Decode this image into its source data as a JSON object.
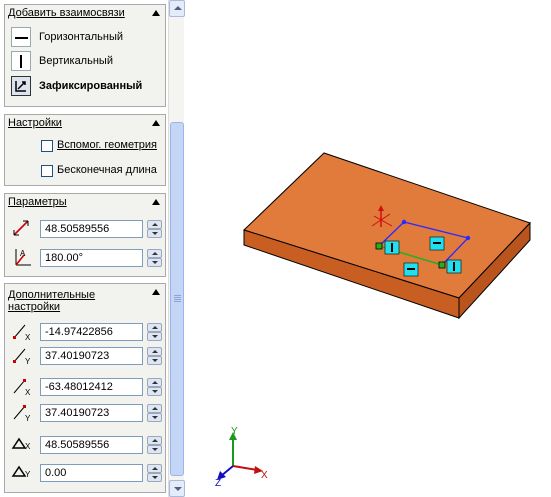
{
  "relations": {
    "title": "Добавить взаимосвязи",
    "items": [
      {
        "label": "Горизонтальный",
        "icon": "horizontal-line-icon"
      },
      {
        "label": "Вертикальный",
        "icon": "vertical-line-icon"
      },
      {
        "label": "Зафиксированный",
        "icon": "fix-anchor-icon"
      }
    ]
  },
  "settings": {
    "title": "Настройки",
    "construction_label": "Вспомог. геометрия",
    "infinite_label": "Бесконечная длина"
  },
  "params": {
    "title": "Параметры",
    "length": "48.50589556",
    "angle": "180.00°"
  },
  "extra": {
    "title": "Дополнительные настройки",
    "start_x": "-14.97422856",
    "start_y": "37.40190723",
    "end_x": "-63.48012412",
    "end_y": "37.40190723",
    "delta_x": "48.50589556",
    "delta_y": "0.00"
  },
  "triad": {
    "x": "X",
    "y": "Y",
    "z": "Z"
  },
  "colors": {
    "plate_top": "#e07b3c",
    "plate_side": "#c95e22",
    "accent": "#2a2aff"
  }
}
